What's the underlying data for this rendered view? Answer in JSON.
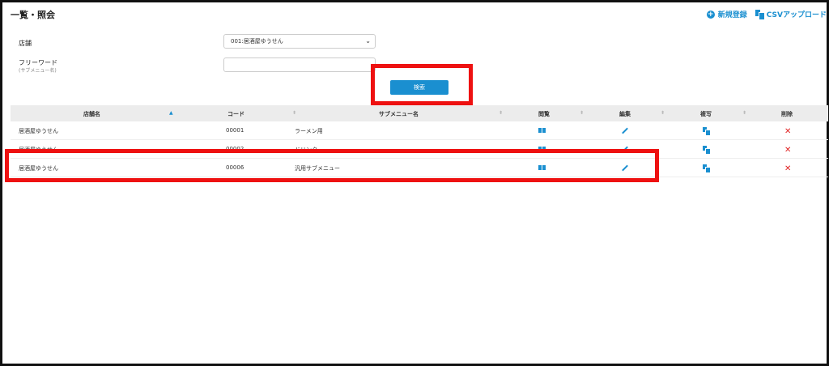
{
  "header": {
    "title": "一覧・照会",
    "new_label": "新規登録",
    "csv_label": "CSVアップロード"
  },
  "form": {
    "store_label": "店舗",
    "store_value": "001:居酒屋ゆうせん",
    "free_word_label": "フリーワード",
    "free_word_sub": "(サブメニュー名)",
    "free_word_value": "",
    "search_label": "検索"
  },
  "table": {
    "headers": {
      "store": "店舗名",
      "code": "コード",
      "submenu": "サブメニュー名",
      "view": "閲覧",
      "edit": "編集",
      "copy": "複写",
      "delete": "削除"
    },
    "sort_active_icon": "▲",
    "sort_icon": "⬍",
    "rows": [
      {
        "store": "居酒屋ゆうせん",
        "code": "00001",
        "submenu": "ラーメン用"
      },
      {
        "store": "居酒屋ゆうせん",
        "code": "00002",
        "submenu": "ドリンク"
      },
      {
        "store": "居酒屋ゆうせん",
        "code": "00006",
        "submenu": "汎用サブメニュー"
      }
    ],
    "delete_icon": "✕"
  },
  "icons": {
    "new": "add-circle-icon",
    "csv": "copy-icon",
    "view": "book-icon",
    "edit": "pencil-icon",
    "copy": "copy-icon",
    "delete": "close-icon"
  },
  "colors": {
    "accent": "#1a8fd0",
    "highlight": "#ee1111",
    "delete": "#e02020"
  }
}
